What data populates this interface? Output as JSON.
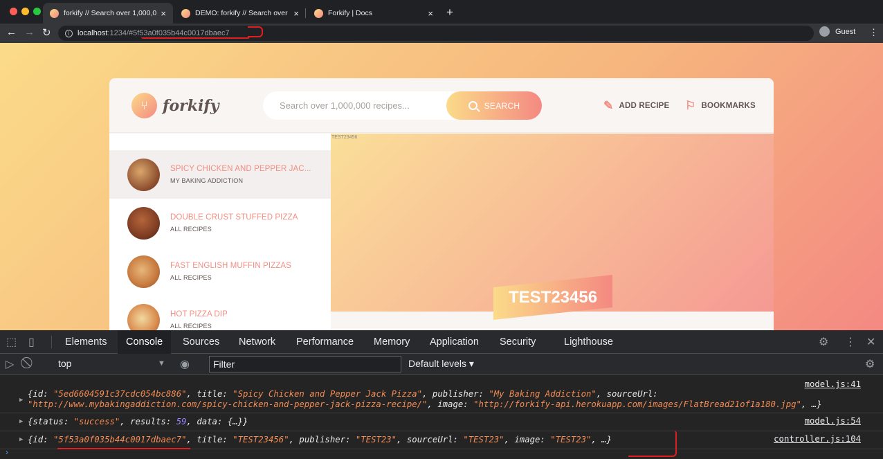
{
  "browser": {
    "tabs": [
      {
        "title": "forkify // Search over 1,000,000 recipes",
        "active": true
      },
      {
        "title": "DEMO: forkify // Search over 1,000,000 recipes",
        "active": false
      },
      {
        "title": "Forkify | Docs",
        "active": false
      }
    ],
    "address": {
      "host": "localhost",
      "path": ":1234/#5f53a0f035b44c0017dbaec7"
    },
    "profile": "Guest"
  },
  "app": {
    "logo_text": "forkify",
    "search": {
      "placeholder": "Search over 1,000,000 recipes...",
      "button_label": "SEARCH"
    },
    "nav": {
      "add_recipe": "ADD RECIPE",
      "bookmarks": "BOOKMARKS"
    },
    "results": [
      {
        "title": "SPICY CHICKEN AND PEPPER JAC...",
        "publisher": "MY BAKING ADDICTION",
        "selected": true
      },
      {
        "title": "DOUBLE CRUST STUFFED PIZZA",
        "publisher": "ALL RECIPES",
        "selected": false
      },
      {
        "title": "FAST ENGLISH MUFFIN PIZZAS",
        "publisher": "ALL RECIPES",
        "selected": false
      },
      {
        "title": "HOT PIZZA DIP",
        "publisher": "ALL RECIPES",
        "selected": false
      }
    ],
    "recipe": {
      "image_alt": "TEST23456",
      "title": "TEST23456"
    }
  },
  "devtools": {
    "tabs": [
      "Elements",
      "Console",
      "Sources",
      "Network",
      "Performance",
      "Memory",
      "Application",
      "Security",
      "Lighthouse"
    ],
    "active_tab": "Console",
    "context": "top",
    "filter_placeholder": "Filter",
    "levels": "Default levels",
    "logs": [
      {
        "source": "model.js:41"
      },
      {
        "source": "model.js:54"
      },
      {
        "source": "controller.js:104"
      }
    ]
  },
  "colors": {
    "accent": "#f38e82",
    "gradient_start": "#fbdb89",
    "gradient_end": "#f48982",
    "annotation": "#e02020"
  }
}
